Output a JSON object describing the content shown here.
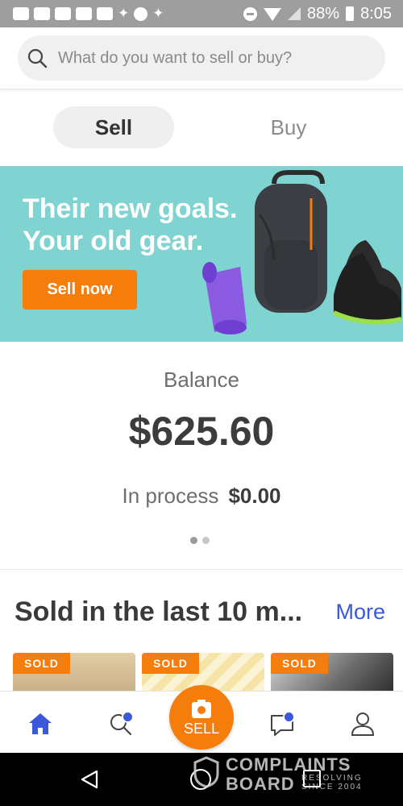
{
  "status_bar": {
    "battery": "88%",
    "time": "8:05",
    "icons": [
      "screenshot-icon",
      "youtube-icon",
      "youtube-icon",
      "youtube-icon",
      "gallery-icon",
      "twitter-icon",
      "app-icon",
      "twitter-icon",
      "dnd-icon",
      "wifi-icon",
      "signal-icon",
      "battery-icon"
    ]
  },
  "search": {
    "placeholder": "What do you want to sell or buy?"
  },
  "toggle": {
    "sell_label": "Sell",
    "buy_label": "Buy",
    "selected": "Sell"
  },
  "banner": {
    "line1": "Their new goals.",
    "line2": "Your old gear.",
    "button_label": "Sell now"
  },
  "balance": {
    "label": "Balance",
    "amount": "$625.60",
    "in_process_label": "In process",
    "in_process_amount": "$0.00"
  },
  "carousel": {
    "page_count": 2,
    "active_page": 1
  },
  "sold_section": {
    "title": "Sold in the last 10 m...",
    "more_label": "More",
    "items": [
      {
        "badge": "SOLD"
      },
      {
        "badge": "SOLD"
      },
      {
        "badge": "SOLD"
      }
    ]
  },
  "bottom_nav": {
    "sell_label": "SELL",
    "items": [
      "home-icon",
      "search-icon",
      "sell-icon",
      "messages-icon",
      "profile-icon"
    ]
  },
  "watermark": {
    "line1": "COMPLAINTS",
    "line2": "BOARD",
    "line3": "RESOLVING SINCE 2004"
  },
  "colors": {
    "accent": "#f47d0c",
    "brand_blue": "#3a58d9",
    "banner_bg": "#7fd3d1"
  }
}
